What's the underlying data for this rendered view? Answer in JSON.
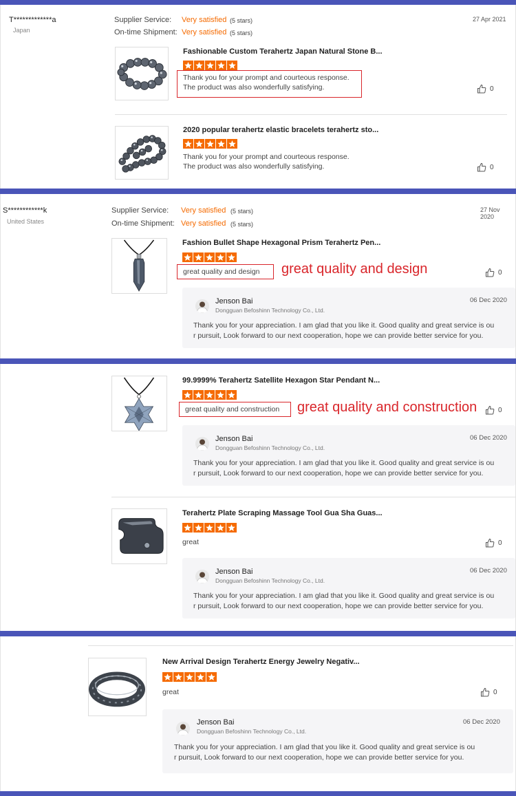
{
  "reviews": [
    {
      "user": "T*************a",
      "country": "Japan",
      "date": "27 Apr 2021",
      "supplier_label": "Supplier Service:",
      "supplier_value": "Very satisfied",
      "supplier_stars": "(5 stars)",
      "shipment_label": "On-time Shipment:",
      "shipment_value": "Very satisfied",
      "shipment_stars": "(5 stars)",
      "items": [
        {
          "title": "Fashionable Custom Terahertz Japan Natural Stone B...",
          "rating": 5,
          "text_line1": "Thank you for your prompt and courteous response.",
          "text_line2": "The product was also wonderfully satisfying.",
          "likes": "0"
        },
        {
          "title": "2020 popular terahertz elastic bracelets terahertz sto...",
          "rating": 5,
          "text_line1": "Thank you for your prompt and courteous response.",
          "text_line2": "The product was also wonderfully satisfying.",
          "likes": "0"
        }
      ]
    },
    {
      "user": "S************k",
      "country": "United States",
      "date": "27 Nov 2020",
      "supplier_label": "Supplier Service:",
      "supplier_value": "Very satisfied",
      "supplier_stars": "(5 stars)",
      "shipment_label": "On-time Shipment:",
      "shipment_value": "Very satisfied",
      "shipment_stars": "(5 stars)",
      "items": [
        {
          "title": "Fashion Bullet Shape Hexagonal Prism Terahertz Pen...",
          "rating": 5,
          "text": "great quality and design",
          "annotation": "great quality and design",
          "likes": "0",
          "reply": {
            "name": "Jenson Bai",
            "company": "Dongguan Befoshinn Technology Co., Ltd.",
            "date": "06 Dec 2020",
            "line1": "Thank you for your appreciation. I am glad that you like it. Good quality and great service is ou",
            "line2": "r pursuit, Look forward to our next cooperation, hope we can provide better service for you."
          }
        }
      ]
    },
    {
      "items": [
        {
          "title": "99.9999% Terahertz Satellite Hexagon Star Pendant N...",
          "rating": 5,
          "text": "great quality and construction",
          "annotation": "great quality and construction",
          "likes": "0",
          "reply": {
            "name": "Jenson Bai",
            "company": "Dongguan Befoshinn Technology Co., Ltd.",
            "date": "06 Dec 2020",
            "line1": "Thank you for your appreciation. I am glad that you like it. Good quality and great service is ou",
            "line2": "r pursuit, Look forward to our next cooperation, hope we can provide better service for you."
          }
        },
        {
          "title": "Terahertz Plate Scraping Massage Tool Gua Sha Guas...",
          "rating": 5,
          "text": "great",
          "likes": "0",
          "reply": {
            "name": "Jenson Bai",
            "company": "Dongguan Befoshinn Technology Co., Ltd.",
            "date": "06 Dec 2020",
            "line1": "Thank you for your appreciation. I am glad that you like it. Good quality and great service is ou",
            "line2": "r pursuit, Look forward to our next cooperation, hope we can provide better service for you."
          }
        }
      ]
    },
    {
      "items": [
        {
          "title": "New Arrival Design Terahertz Energy Jewelry Negativ...",
          "rating": 5,
          "text": "great",
          "likes": "0",
          "reply": {
            "name": "Jenson Bai",
            "company": "Dongguan Befoshinn Technology Co., Ltd.",
            "date": "06 Dec 2020",
            "line1": "Thank you for your appreciation. I am glad that you like it. Good quality and great service is ou",
            "line2": "r pursuit, Look forward to our next cooperation, hope we can provide better service for you."
          }
        }
      ]
    }
  ],
  "icons": {
    "like": "thumbs-up-icon",
    "star": "star-icon"
  },
  "colors": {
    "accent": "#f56a00",
    "separator": "#4a55b8",
    "annotation": "#d9252a"
  }
}
